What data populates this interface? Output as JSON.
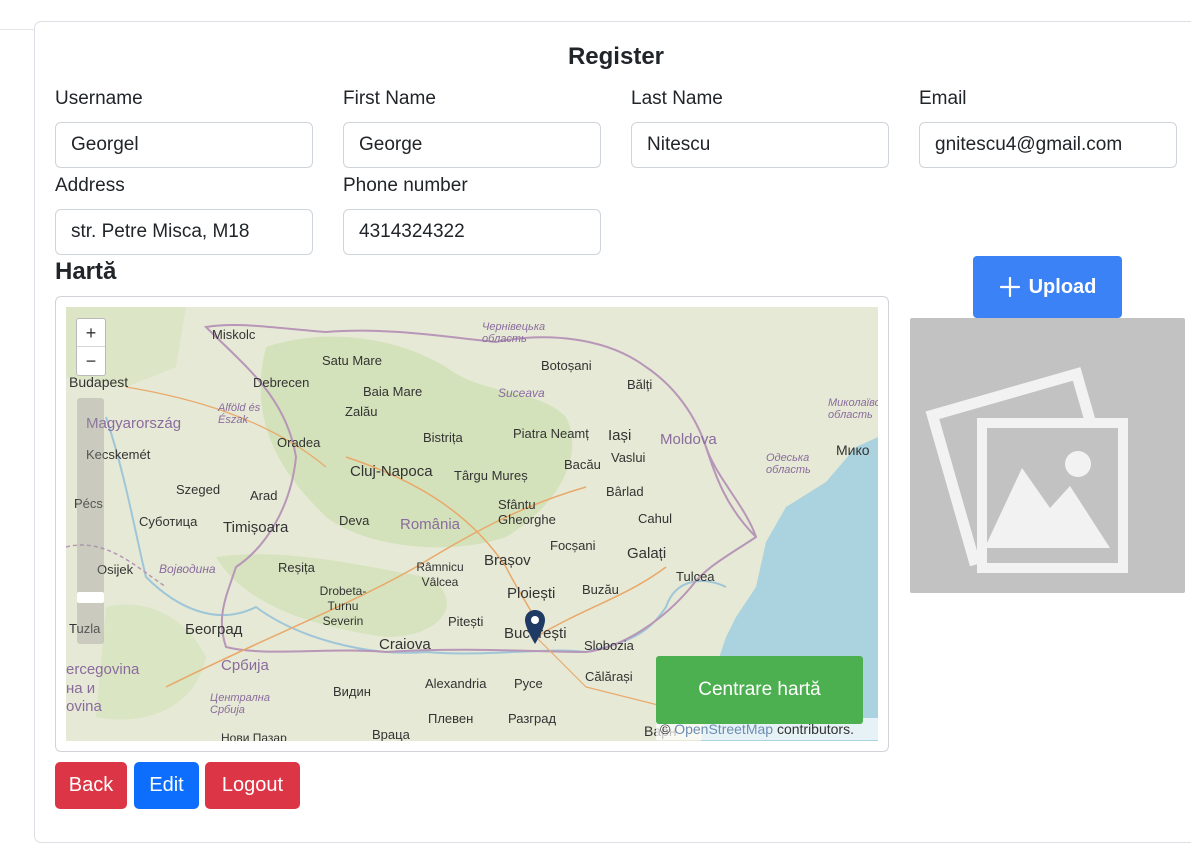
{
  "form": {
    "title": "Register",
    "fields": {
      "username": {
        "label": "Username",
        "value": "Georgel"
      },
      "first_name": {
        "label": "First Name",
        "value": "George"
      },
      "last_name": {
        "label": "Last Name",
        "value": "Nitescu"
      },
      "email": {
        "label": "Email",
        "value": "gnitescu4@gmail.com"
      },
      "address": {
        "label": "Address",
        "value": "str. Petre Misca, M18"
      },
      "phone": {
        "label": "Phone number",
        "value": "4314324322"
      }
    }
  },
  "map": {
    "heading": "Hartă",
    "zoom_in": "+",
    "zoom_out": "−",
    "center_button": "Centrare hartă",
    "attribution_prefix": "© ",
    "attribution_link": "OpenStreetMap",
    "attribution_suffix": " contributors.",
    "place_labels": [
      "Miskolc",
      "Satu Mare",
      "Botoșani",
      "Чернівецька область",
      "Budapest",
      "Debrecen",
      "Baia Mare",
      "Bălți",
      "Suceava",
      "Alföld és Észak",
      "Magyarország",
      "Zalău",
      "Oradea",
      "Bistrița",
      "Piatra Neamț",
      "Iași",
      "Moldova",
      "Миколаївська область",
      "Kecskemét",
      "Cluj-Napoca",
      "Târgu Mureș",
      "Bacău",
      "Vaslui",
      "Одеська область",
      "Мико",
      "Szeged",
      "Arad",
      "Sfântu Gheorghe",
      "Bârlad",
      "Pécs",
      "Суботица",
      "Timișoara",
      "Deva",
      "România",
      "Cahul",
      "Focșani",
      "Osijek",
      "Војводина",
      "Reșița",
      "Râmnicu Vâlcea",
      "Brașov",
      "Galați",
      "Tulcea",
      "Drobeta-Turnu Severin",
      "Ploiești",
      "Buzău",
      "Tuzla",
      "Београд",
      "Pitești",
      "București",
      "Craiova",
      "Slobozia",
      "Србија",
      "ercegovina",
      "Видин",
      "Alexandria",
      "Русе",
      "Călărași",
      "на и",
      "Централна Србија",
      "ovina",
      "Плевен",
      "Разград",
      "Варн",
      "Враца",
      "Нови Пазар"
    ],
    "marker_city": "București"
  },
  "photo": {
    "upload_label": "Upload",
    "upload_icon": "plus-icon",
    "placeholder_icon": "image-placeholder-icon"
  },
  "actions": {
    "back": "Back",
    "edit": "Edit",
    "logout": "Logout"
  },
  "colors": {
    "danger": "#dc3545",
    "primary": "#0d6efd",
    "upload": "#3b82f6",
    "success": "#4caf50",
    "photo_bg": "#c2c2c2",
    "sea": "#aad3df"
  }
}
